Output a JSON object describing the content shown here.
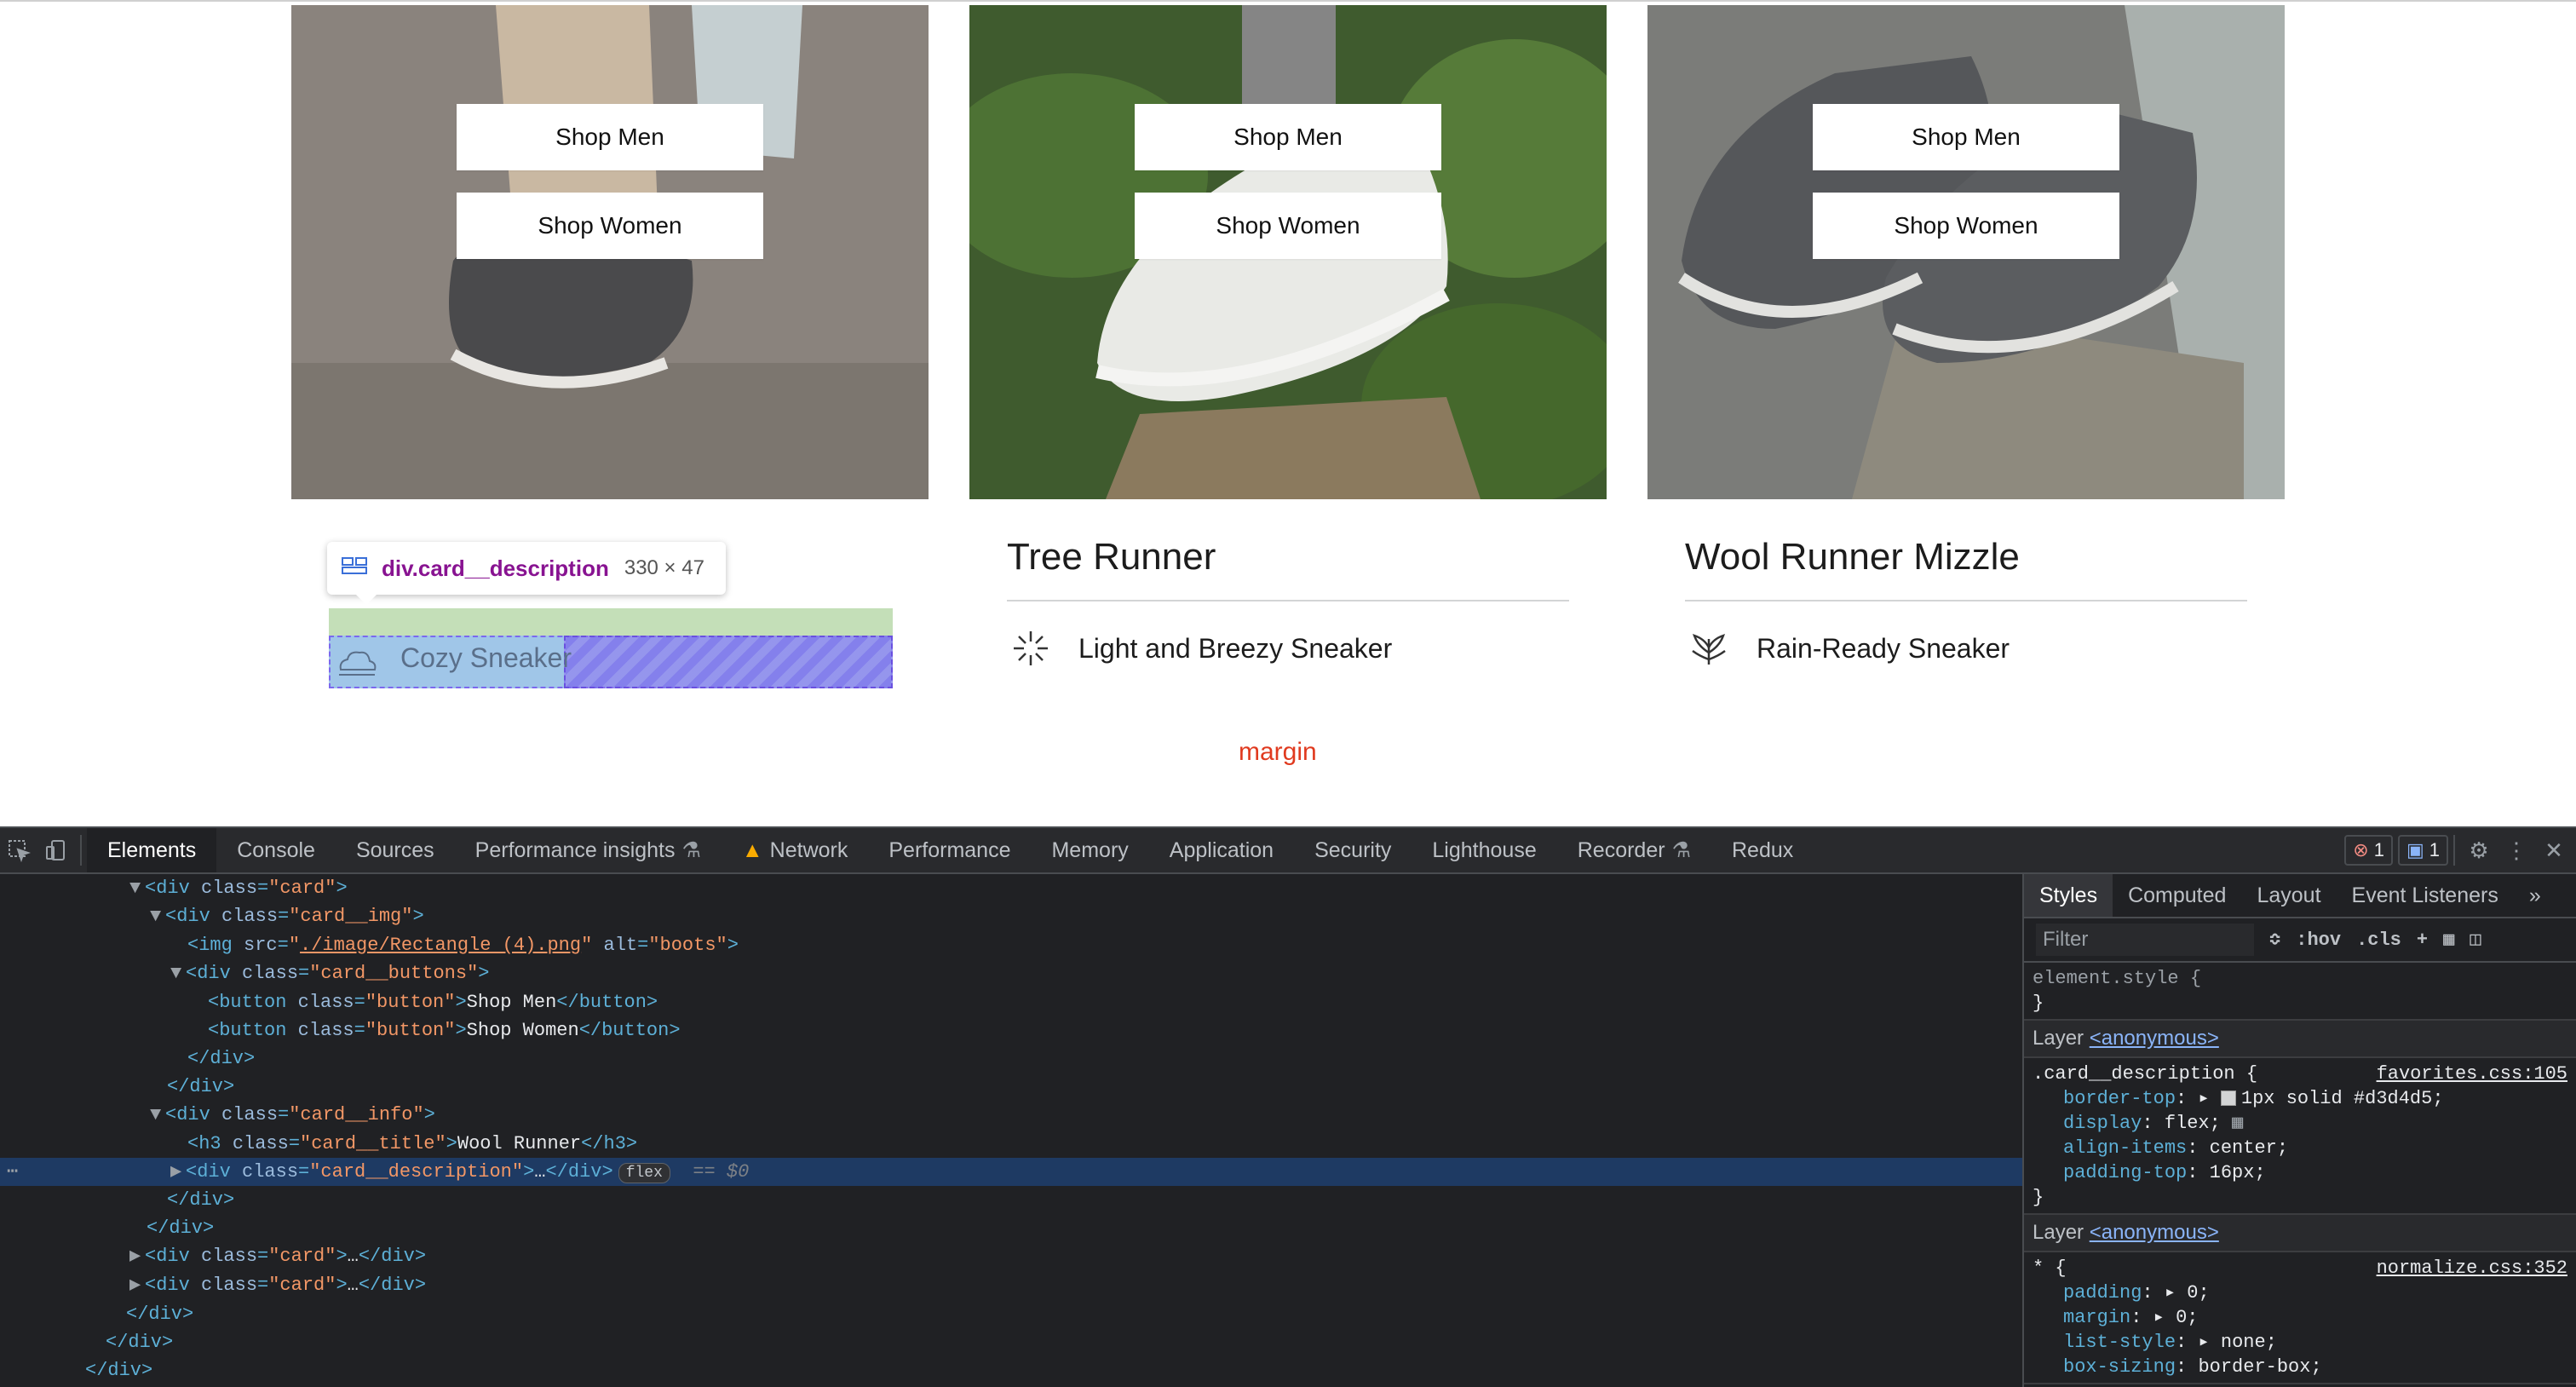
{
  "cards": [
    {
      "title": "Wool Runner",
      "description": "Cozy Sneaker",
      "shop_men": "Shop Men",
      "shop_women": "Shop Women",
      "icon": "cloud-icon"
    },
    {
      "title": "Tree Runner",
      "description": "Light and Breezy Sneaker",
      "shop_men": "Shop Men",
      "shop_women": "Shop Women",
      "icon": "sun-burst-icon"
    },
    {
      "title": "Wool Runner Mizzle",
      "description": "Rain-Ready Sneaker",
      "shop_men": "Shop Men",
      "shop_women": "Shop Women",
      "icon": "leaf-icon"
    }
  ],
  "overlay": {
    "tooltip_name": "div.card__description",
    "tooltip_size": "330 × 47",
    "margin_label": "margin"
  },
  "devtools": {
    "tabs": [
      "Elements",
      "Console",
      "Sources",
      "Performance insights",
      "Network",
      "Performance",
      "Memory",
      "Application",
      "Security",
      "Lighthouse",
      "Recorder",
      "Redux"
    ],
    "active_tab": "Elements",
    "error_count": "1",
    "message_count": "1",
    "dom": {
      "img_src": "./image/Rectangle (4).png",
      "img_alt": "boots",
      "btn_men": "Shop Men",
      "btn_women": "Shop Women",
      "h3_text": "Wool Runner",
      "flex_badge": "flex",
      "sel_marker": "== $0"
    },
    "styles_tabs": [
      "Styles",
      "Computed",
      "Layout",
      "Event Listeners"
    ],
    "filter_placeholder": "Filter",
    "hov": ":hov",
    "cls": ".cls",
    "element_style": "element.style {",
    "layer_label": "Layer",
    "layer_link": "<anonymous>",
    "rule1": {
      "selector": ".card__description {",
      "source": "favorites.css:105",
      "props": [
        {
          "name": "border-top",
          "value": "1px solid #d3d4d5;"
        },
        {
          "name": "display",
          "value": "flex;"
        },
        {
          "name": "align-items",
          "value": "center;"
        },
        {
          "name": "padding-top",
          "value": "16px;"
        }
      ]
    },
    "rule2": {
      "selector": "* {",
      "source": "normalize.css:352",
      "props": [
        {
          "name": "padding",
          "value": "0;"
        },
        {
          "name": "margin",
          "value": "0;"
        },
        {
          "name": "list-style",
          "value": "none;"
        },
        {
          "name": "box-sizing",
          "value": "border-box;"
        }
      ]
    }
  }
}
